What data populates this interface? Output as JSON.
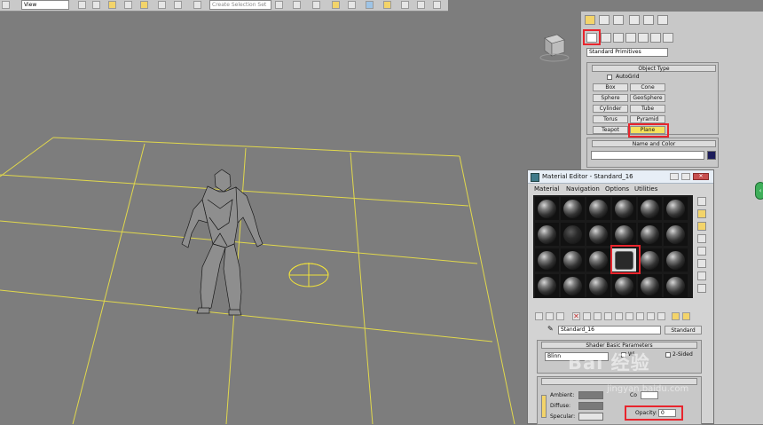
{
  "toolbar": {
    "selection_filter": "View",
    "named_selection_placeholder": "Create Selection Set"
  },
  "command_panel": {
    "category_dropdown": "Standard Primitives",
    "object_type": {
      "title": "Object Type",
      "autogrid_label": "AutoGrid",
      "buttons": [
        "Box",
        "Cone",
        "Sphere",
        "GeoSphere",
        "Cylinder",
        "Tube",
        "Torus",
        "Pyramid",
        "Teapot",
        "Plane"
      ],
      "active": "Plane"
    },
    "name_color": {
      "title": "Name and Color",
      "color": "#1d1d5a"
    }
  },
  "material_editor": {
    "title": "Material Editor - Standard_16",
    "menu": [
      "Material",
      "Navigation",
      "Options",
      "Utilities"
    ],
    "material_name": "Standard_16",
    "material_type_button": "Standard",
    "shader_rollout_title": "Shader Basic Parameters",
    "shader": "Blinn",
    "two_sided_label": "2-Sided",
    "wire_label": "Wi",
    "ambient_label": "Ambient:",
    "diffuse_label": "Diffuse:",
    "specular_label": "Specular:",
    "color_label": "Co",
    "opacity_label": "Opacity:",
    "opacity_value": "0"
  },
  "watermark": {
    "text": "Bai 经验",
    "url": "jingyan.baidu.com"
  },
  "colors": {
    "viewport_bg": "#7d7d7d",
    "grid": "#e1d84c",
    "highlight": "#e8252d",
    "active_button": "#f6e25b"
  }
}
